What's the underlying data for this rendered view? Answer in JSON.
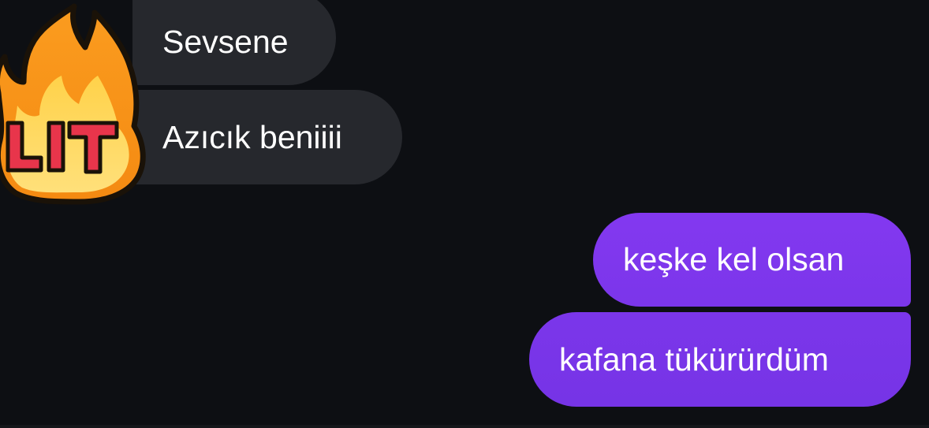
{
  "chat": {
    "received": [
      {
        "text": "Sevsene"
      },
      {
        "text": "Azıcık beniiii"
      }
    ],
    "sent": [
      {
        "text": "keşke kel olsan"
      },
      {
        "text": "kafana tükürürdüm"
      }
    ]
  },
  "sticker": {
    "text": "LIT",
    "icon": "fire-lit-sticker-icon"
  },
  "colors": {
    "background": "#0d0f13",
    "received_bubble": "#26282d",
    "sent_bubble": "#7c35ea",
    "text": "#ffffff"
  }
}
